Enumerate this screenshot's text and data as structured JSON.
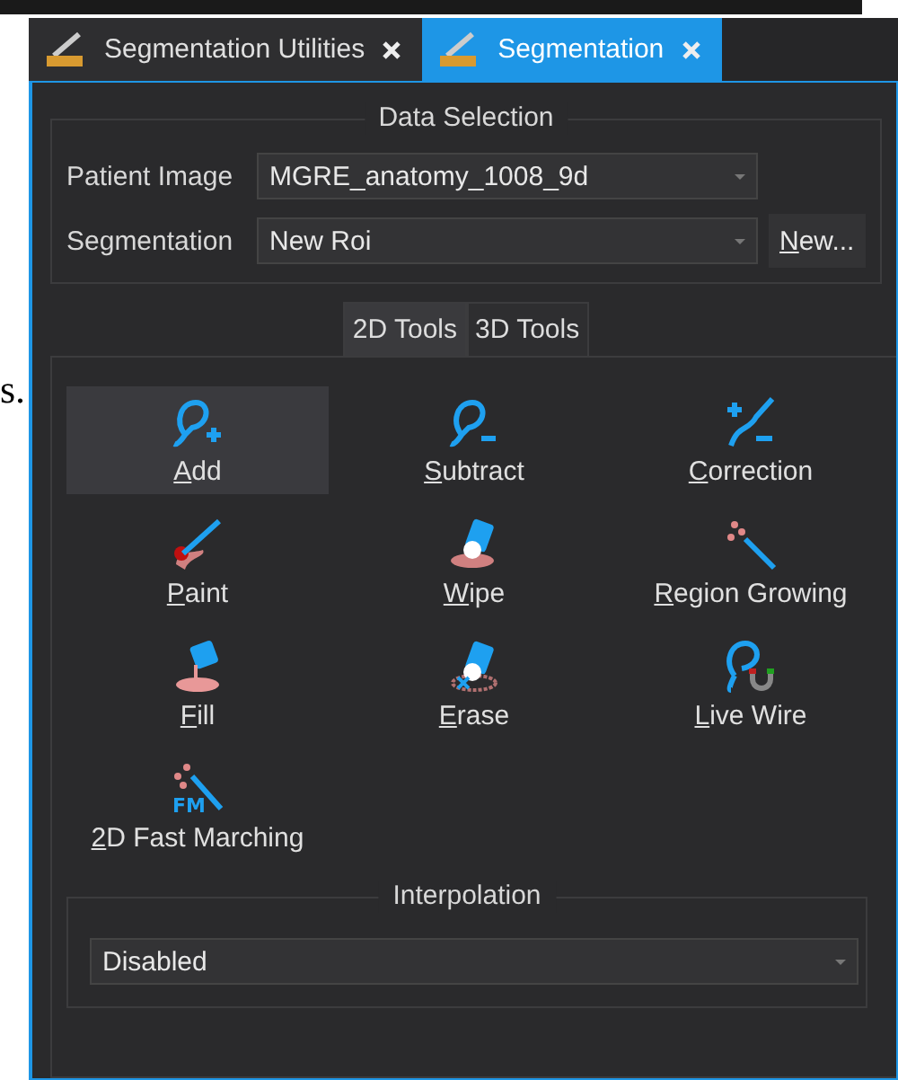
{
  "outside_text": "s.",
  "tabs": [
    {
      "label": "Segmentation Utilities",
      "selected": false
    },
    {
      "label": "Segmentation",
      "selected": true
    }
  ],
  "data_selection": {
    "title": "Data Selection",
    "rows": [
      {
        "label": "Patient Image",
        "value": "MGRE_anatomy_1008_9d"
      },
      {
        "label": "Segmentation",
        "value": "New Roi",
        "button": "New..."
      }
    ]
  },
  "tool_tabs": [
    {
      "label": "2D Tools",
      "selected": true
    },
    {
      "label": "3D Tools",
      "selected": false
    }
  ],
  "tools": [
    {
      "label": "Add",
      "selected": true
    },
    {
      "label": "Subtract",
      "selected": false
    },
    {
      "label": "Correction",
      "selected": false
    },
    {
      "label": "Paint",
      "selected": false
    },
    {
      "label": "Wipe",
      "selected": false
    },
    {
      "label": "Region Growing",
      "selected": false
    },
    {
      "label": "Fill",
      "selected": false
    },
    {
      "label": "Erase",
      "selected": false
    },
    {
      "label": "Live Wire",
      "selected": false
    },
    {
      "label": "2D Fast Marching",
      "selected": false,
      "icon_text": "FM"
    }
  ],
  "interpolation": {
    "title": "Interpolation",
    "value": "Disabled"
  }
}
